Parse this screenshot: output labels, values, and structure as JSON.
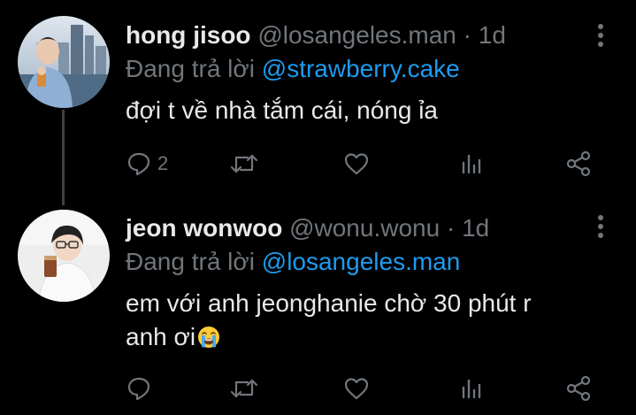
{
  "colors": {
    "background": "#000000",
    "text": "#e7e9ea",
    "muted": "#71767b",
    "link": "#1d9bf0",
    "thread_line": "#3e4144"
  },
  "tweets": [
    {
      "name": "hong jisoo",
      "handle": "@losangeles.man",
      "separator": "·",
      "time": "1d",
      "reply_prefix": "Đang trả lời",
      "reply_to": "@strawberry.cake",
      "text": "đợi t về nhà tắm cái, nóng ỉa",
      "reply_count": "2",
      "avatar": "avatar-photo",
      "icons": [
        "reply-icon",
        "retweet-icon",
        "like-icon",
        "views-icon",
        "share-icon",
        "more-icon"
      ]
    },
    {
      "name": "jeon wonwoo",
      "handle": "@wonu.wonu",
      "separator": "·",
      "time": "1d",
      "reply_prefix": "Đang trả lời",
      "reply_to": "@losangeles.man",
      "text_line1": "em với anh jeonghanie chờ 30 phút r",
      "text_line2": "anh ơi",
      "emoji": "loudly-crying-face-emoji",
      "reply_count": "",
      "avatar": "avatar-photo",
      "icons": [
        "reply-icon",
        "retweet-icon",
        "like-icon",
        "views-icon",
        "share-icon",
        "more-icon"
      ]
    }
  ]
}
